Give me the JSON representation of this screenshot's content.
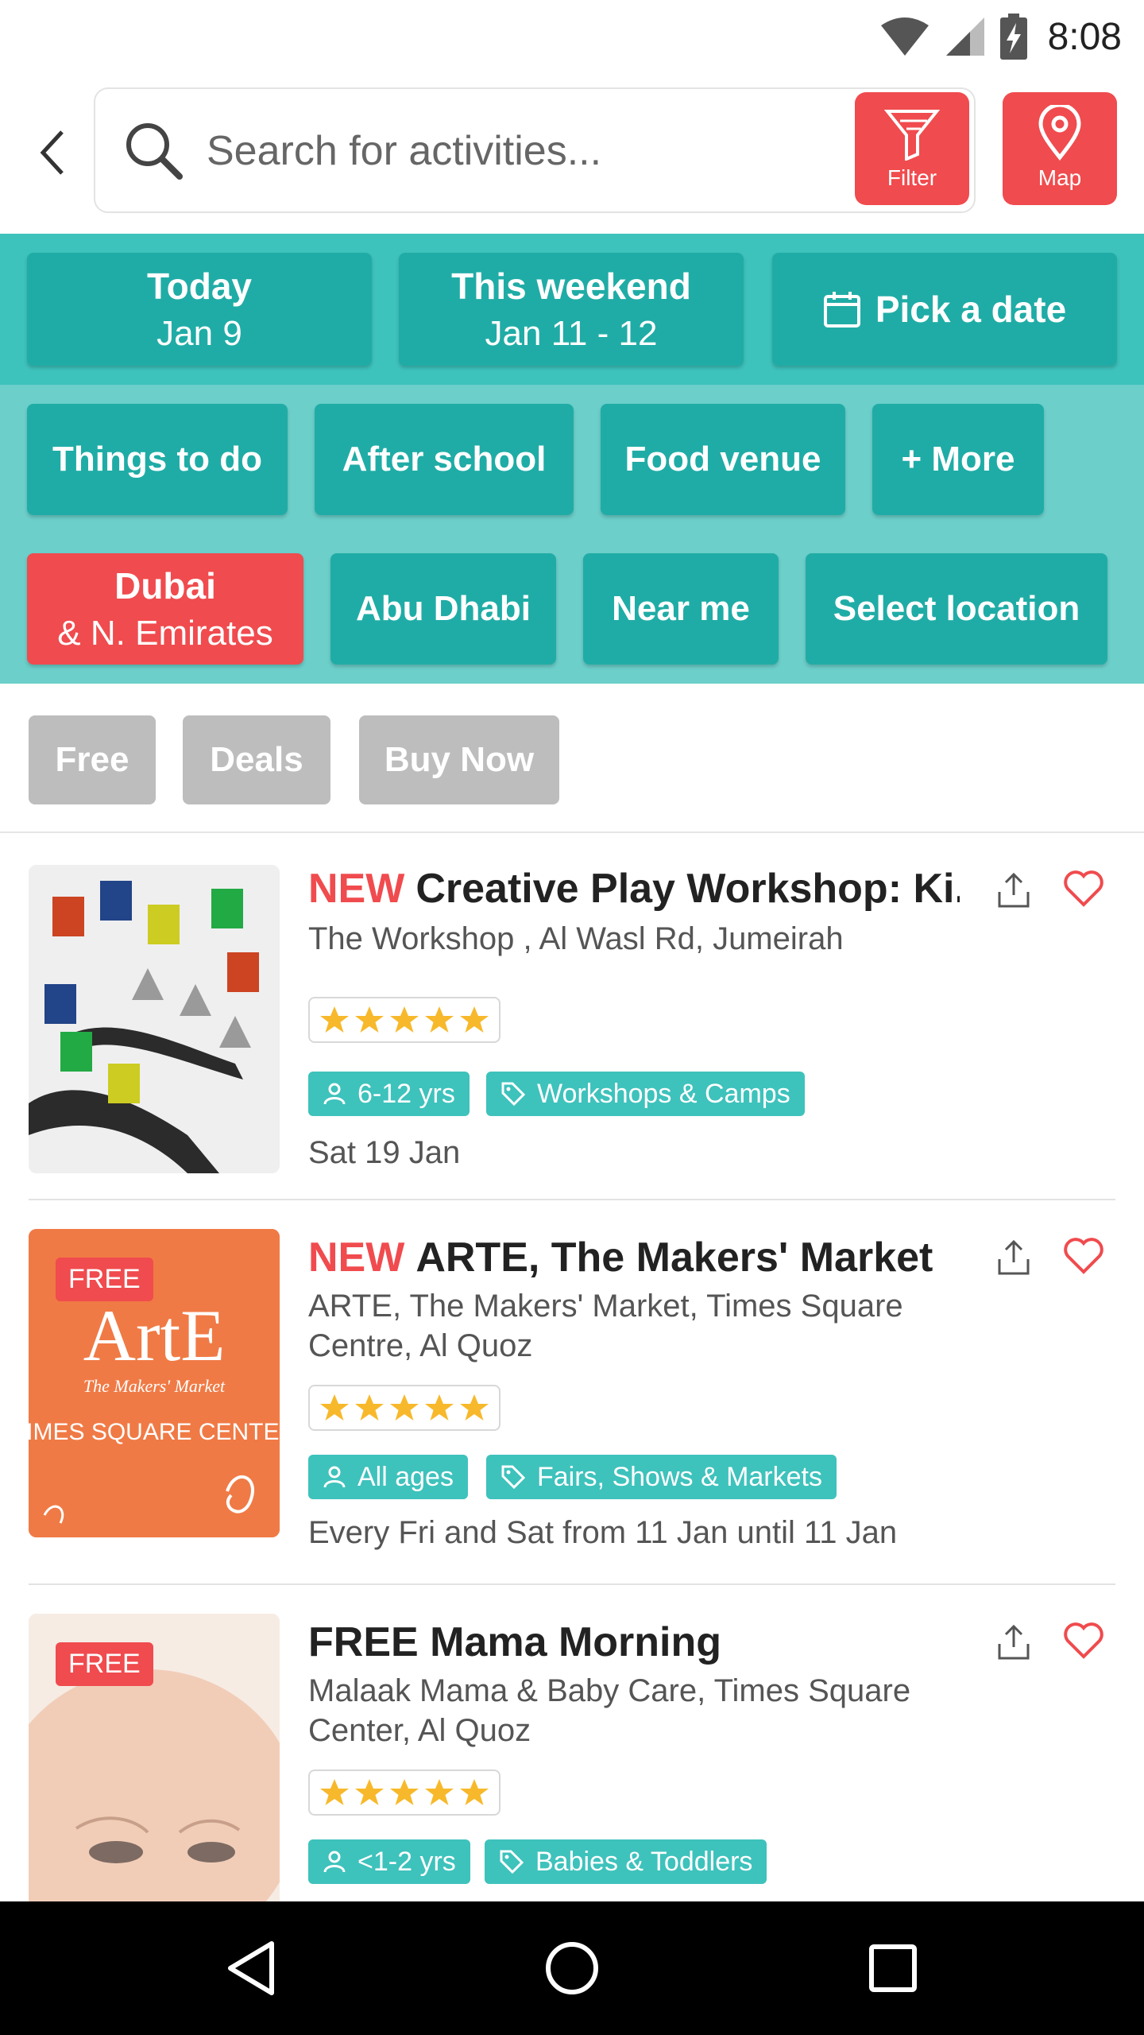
{
  "status": {
    "time": "8:08"
  },
  "search": {
    "placeholder": "Search for activities...",
    "filter_label": "Filter",
    "map_label": "Map"
  },
  "dates": [
    {
      "title": "Today",
      "sub": "Jan 9"
    },
    {
      "title": "This weekend",
      "sub": "Jan 11 - 12"
    },
    {
      "title": "Pick a date"
    }
  ],
  "categories": [
    "Things to do",
    "After school",
    "Food venue",
    "+ More"
  ],
  "locations": [
    {
      "title": "Dubai",
      "sub": "& N. Emirates"
    },
    {
      "title": "Abu Dhabi"
    },
    {
      "title": "Near me"
    },
    {
      "title": "Select location"
    }
  ],
  "pills": [
    "Free",
    "Deals",
    "Buy Now"
  ],
  "listings": [
    {
      "badge": "NEW",
      "title": "Creative Play Workshop: Ki...",
      "venue": "The Workshop , Al Wasl Rd, Jumeirah",
      "rating": 5,
      "age": "6-12 yrs",
      "category": "Workshops & Camps",
      "date": "Sat 19 Jan"
    },
    {
      "badge": "NEW",
      "free": "FREE",
      "title": "ARTE, The Makers' Market",
      "venue": "ARTE, The Makers' Market, Times Square Centre, Al Quoz",
      "rating": 5,
      "age": "All ages",
      "category": "Fairs, Shows & Markets",
      "date": "Every Fri and Sat from 11 Jan until 11 Jan",
      "image_text": {
        "logo": "ArtE",
        "sub": "The Makers' Market",
        "place": "TIMES SQUARE CENTER"
      }
    },
    {
      "free": "FREE",
      "title": "FREE Mama Morning",
      "venue": "Malaak Mama & Baby Care, Times Square Center, Al Quoz",
      "rating": 5,
      "age": "<1-2 yrs",
      "category": "Babies & Toddlers"
    }
  ],
  "colors": {
    "teal": "#3ec2bc",
    "teal_light": "#6ccfca",
    "chip": "#20aca6",
    "red": "#f04b4e",
    "gray_pill": "#bdbdbd",
    "star": "#f7b92b"
  }
}
